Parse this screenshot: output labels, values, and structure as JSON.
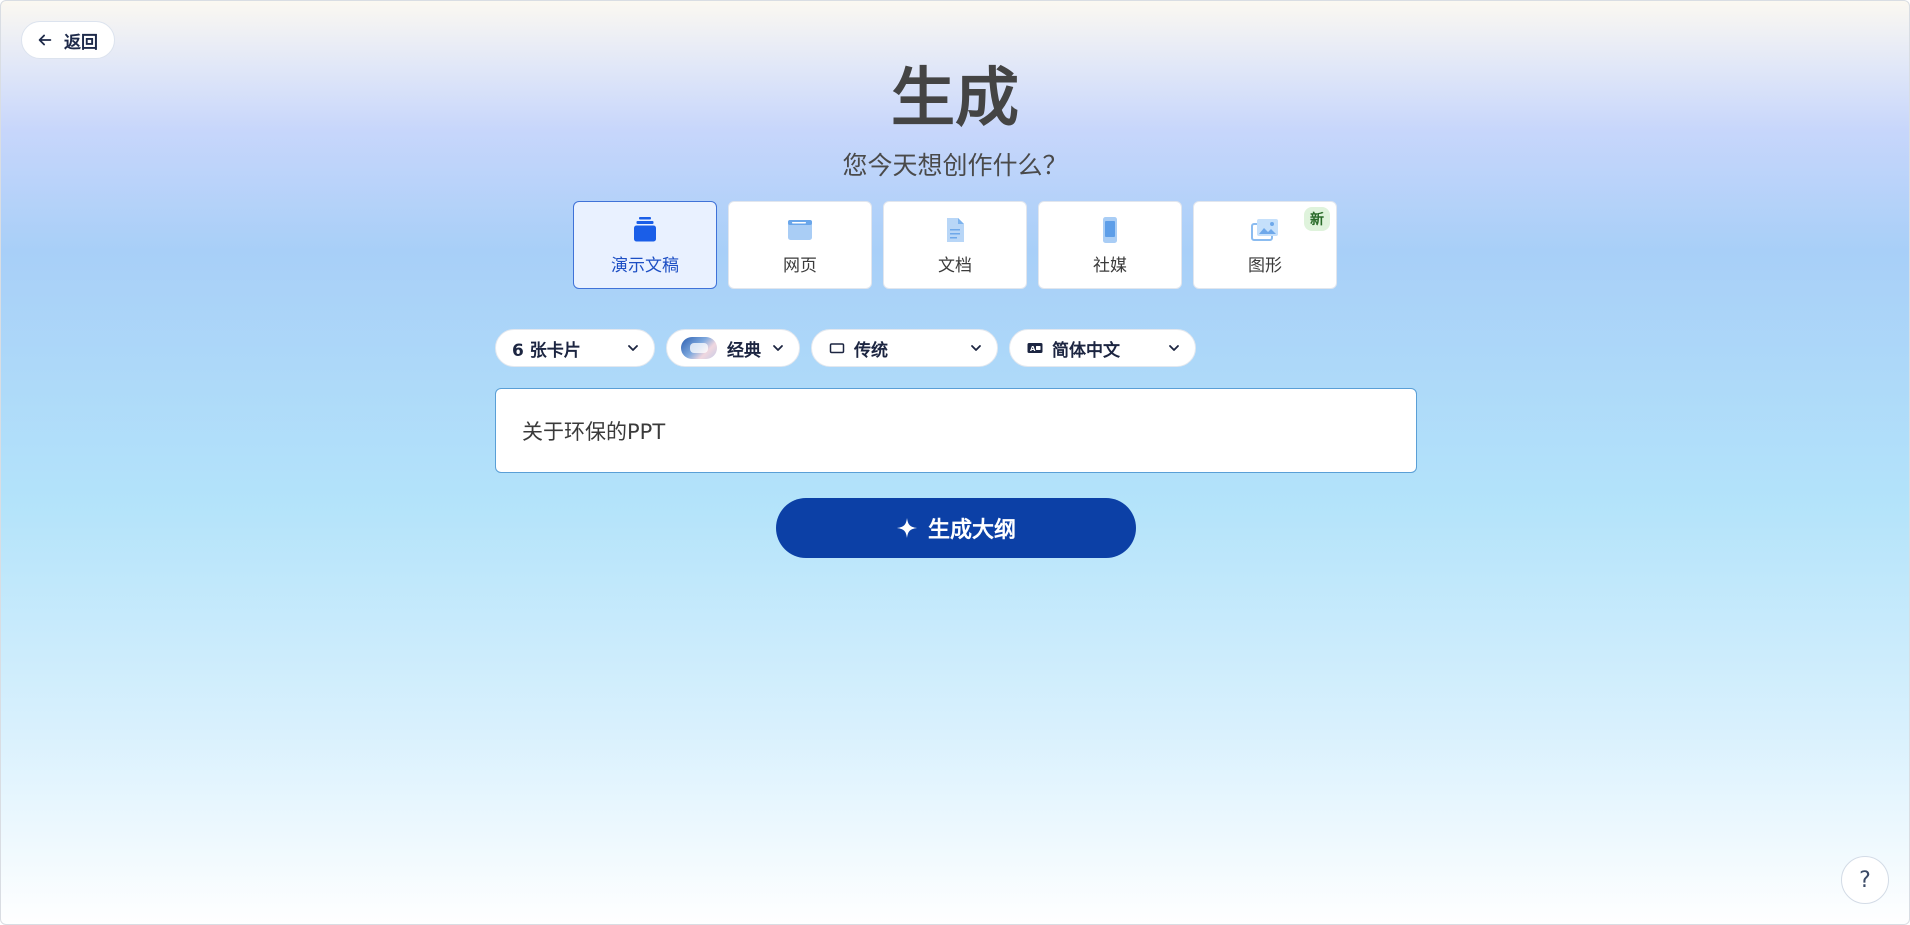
{
  "header": {
    "back_label": "返回",
    "back_icon": "arrow-left-icon"
  },
  "hero": {
    "title": "生成",
    "subtitle": "您今天想创作什么？"
  },
  "types": [
    {
      "label": "演示文稿",
      "icon": "presentation-stack-icon",
      "active": true
    },
    {
      "label": "网页",
      "icon": "webpage-icon",
      "active": false
    },
    {
      "label": "文档",
      "icon": "document-icon",
      "active": false
    },
    {
      "label": "社媒",
      "icon": "phone-icon",
      "active": false
    },
    {
      "label": "图形",
      "icon": "image-icon",
      "active": false,
      "badge": "新"
    }
  ],
  "options": {
    "cards": "6 张卡片",
    "theme": "经典",
    "style": "传统",
    "language": "简体中文"
  },
  "prompt": {
    "value": "关于环保的PPT"
  },
  "generate": {
    "label": "生成大纲",
    "icon": "sparkle-icon"
  },
  "help": {
    "label": "?"
  },
  "colors": {
    "accent": "#0c40a6",
    "active_card_bg": "#e9f1ff",
    "active_card_border": "#3f72d8",
    "badge_bg": "#dff3dc"
  }
}
